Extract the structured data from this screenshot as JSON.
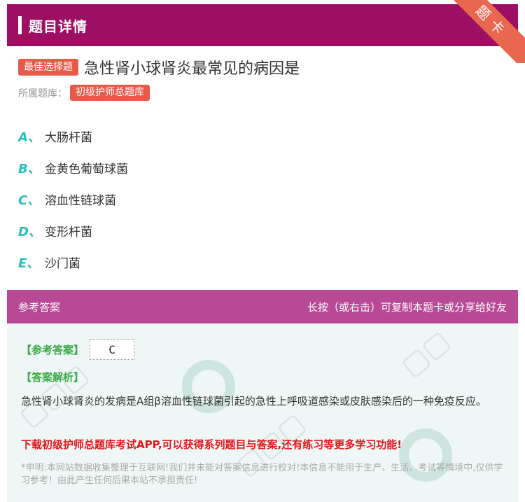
{
  "header": {
    "title": "题目详情"
  },
  "ribbon": {
    "label": "题卡"
  },
  "question": {
    "type_badge": "最佳选择题",
    "title": "急性肾小球肾炎最常见的病因是",
    "bank_label": "所属题库：",
    "bank_name": "初级护师总题库"
  },
  "options": [
    {
      "letter": "A、",
      "text": "大肠杆菌"
    },
    {
      "letter": "B、",
      "text": "金黄色葡萄球菌"
    },
    {
      "letter": "C、",
      "text": "溶血性链球菌"
    },
    {
      "letter": "D、",
      "text": "变形杆菌"
    },
    {
      "letter": "E、",
      "text": "沙门菌"
    }
  ],
  "answer_section": {
    "header_left": "参考答案",
    "header_right": "长按（或右击）可复制本题卡或分享给好友",
    "ref_label": "【参考答案】",
    "ref_value": "C",
    "analysis_label": "【答案解析】",
    "analysis_text": "急性肾小球肾炎的发病是A组β溶血性链球菌引起的急性上呼吸道感染或皮肤感染后的一种免疫反应。",
    "promo": "下载初级护师总题库考试APP,可以获得系列题目与答案,还有练习等更多学习功能!",
    "disclaimer": "*申明:本网站数据收集整理于互联网!我们并未能对答案信息进行校对!本信息不能用于生产、生活、考试等情境中,仅供学习参考！由此产生任何后果本站不承担责任!"
  },
  "colors": {
    "header_bg": "#9c0f62",
    "answer_header_bg": "#b84a95",
    "badge": "#e8594a",
    "option_letter": "#2bbcbc",
    "green_label": "#3aa845",
    "promo": "#e0161b"
  }
}
